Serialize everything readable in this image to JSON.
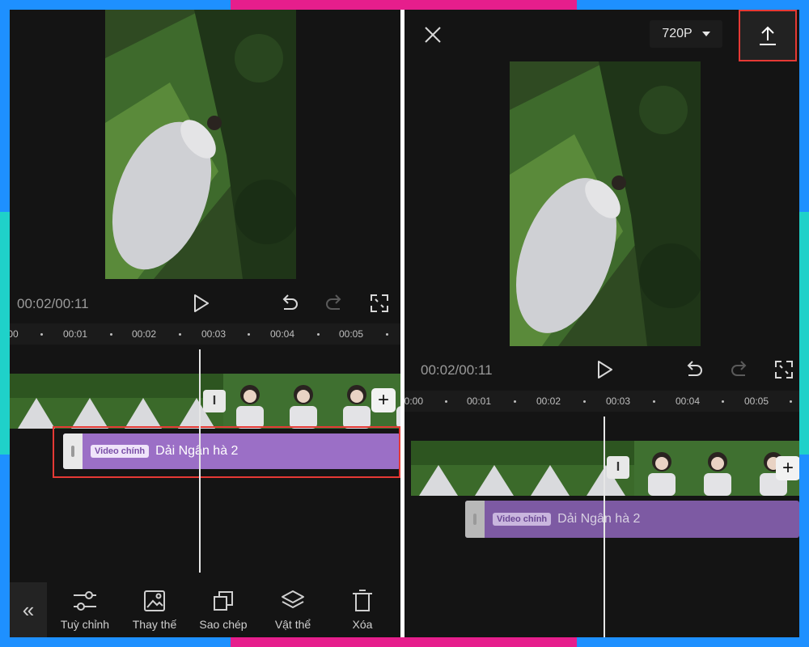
{
  "colors": {
    "frame_blue": "#1e90ff",
    "frame_pink": "#e61e8c",
    "frame_teal": "#1fd1c9",
    "panel_bg": "#141414",
    "audio_track": "#9b6fc6",
    "highlight_red": "#e53935"
  },
  "left_panel": {
    "timecode": "00:02/00:11",
    "ruler_ticks": [
      "00",
      "00:01",
      "00:02",
      "00:03",
      "00:04",
      "00:05"
    ],
    "audio_track": {
      "badge": "Video chính",
      "title": "Dải Ngân hà 2"
    },
    "toolbar": {
      "back_icon": "double-chevron-left-icon",
      "items": [
        {
          "label": "Tuỳ chỉnh",
          "icon": "sliders-icon"
        },
        {
          "label": "Thay thế",
          "icon": "replace-image-icon"
        },
        {
          "label": "Sao chép",
          "icon": "copy-icon"
        },
        {
          "label": "Vật thể",
          "icon": "layers-icon"
        },
        {
          "label": "Xóa",
          "icon": "trash-icon"
        }
      ]
    }
  },
  "right_panel": {
    "resolution": "720P",
    "timecode": "00:02/00:11",
    "ruler_ticks": [
      "00:00",
      "00:01",
      "00:02",
      "00:03",
      "00:04",
      "00:05"
    ],
    "audio_track": {
      "badge": "Video chính",
      "title": "Dải Ngân hà 2"
    }
  }
}
